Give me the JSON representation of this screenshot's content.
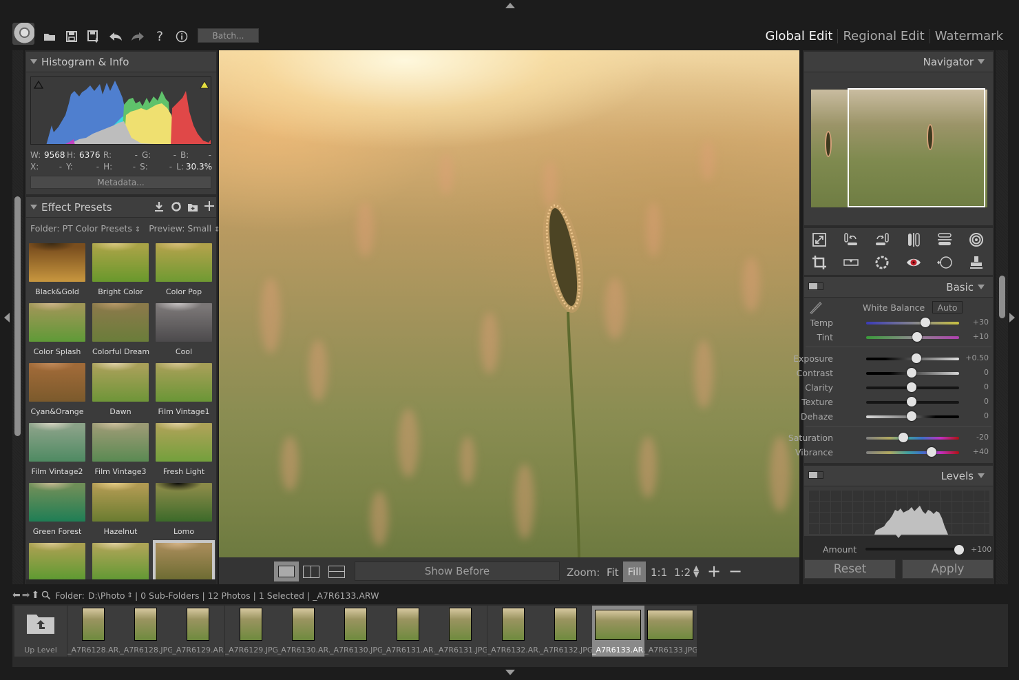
{
  "toolbar": {
    "icons": [
      "app-logo",
      "open-folder",
      "save",
      "save-as",
      "undo",
      "redo",
      "help",
      "info"
    ],
    "batch_label": "Batch...",
    "modes": [
      "Global Edit",
      "Regional Edit",
      "Watermark"
    ],
    "active_mode": "Global Edit"
  },
  "histogram_panel": {
    "title": "Histogram & Info",
    "info": {
      "w_label": "W:",
      "w": "9568",
      "h_label": "H:",
      "h": "6376",
      "r_label": "R:",
      "r": "-",
      "g_label": "G:",
      "g": "-",
      "b_label": "B:",
      "b": "-",
      "x_label": "X:",
      "x": "-",
      "y_label": "Y:",
      "y": "-",
      "hh_label": "H:",
      "hh": "-",
      "s_label": "S:",
      "s": "-",
      "l_label": "L:",
      "l": "30.3%"
    },
    "metadata_label": "Metadata..."
  },
  "presets_panel": {
    "title": "Effect Presets",
    "folder_label": "Folder:",
    "folder_value": "PT Color Presets",
    "preview_label": "Preview:",
    "preview_value": "Small",
    "presets": [
      {
        "name": "Black&Gold",
        "c1": "#7a4e1e",
        "c2": "#c8973f",
        "c3": "#3b2a12"
      },
      {
        "name": "Bright Color",
        "c1": "#a8a346",
        "c2": "#69982c",
        "c3": "#d9c882"
      },
      {
        "name": "Color Pop",
        "c1": "#b0a24a",
        "c2": "#6f9a32",
        "c3": "#d8c07a"
      },
      {
        "name": "Color Splash",
        "c1": "#9e9656",
        "c2": "#5f9a37",
        "c3": "#cdb58a"
      },
      {
        "name": "Colorful Dream",
        "c1": "#8a7a4a",
        "c2": "#6a7d3a",
        "c3": "#b89a6a"
      },
      {
        "name": "Cool",
        "c1": "#7b7777",
        "c2": "#4c4a4c",
        "c3": "#c8c4c4"
      },
      {
        "name": "Cyan&Orange",
        "c1": "#a06a38",
        "c2": "#7b5a2c",
        "c3": "#c08a5a"
      },
      {
        "name": "Dawn",
        "c1": "#a8a059",
        "c2": "#6e9538",
        "c3": "#e0d2a8"
      },
      {
        "name": "Film Vintage1",
        "c1": "#a59f57",
        "c2": "#6a9636",
        "c3": "#d6c692"
      },
      {
        "name": "Film Vintage2",
        "c1": "#8aa288",
        "c2": "#4e8a62",
        "c3": "#d4d2c0"
      },
      {
        "name": "Film Vintage3",
        "c1": "#9a9a74",
        "c2": "#5a8a52",
        "c3": "#ccc09e"
      },
      {
        "name": "Fresh Light",
        "c1": "#aca257",
        "c2": "#73a03c",
        "c3": "#e0d0a0"
      },
      {
        "name": "Green Forest",
        "c1": "#6e8e58",
        "c2": "#1f7e55",
        "c3": "#c4b892"
      },
      {
        "name": "Hazelnut",
        "c1": "#b09a52",
        "c2": "#6a7c30",
        "c3": "#e4cc86"
      },
      {
        "name": "Lomo",
        "c1": "#8a8a48",
        "c2": "#3c6a2a",
        "c3": "#0a0a08"
      },
      {
        "name": "",
        "c1": "#a8a050",
        "c2": "#5a9a30",
        "c3": "#d8c890"
      },
      {
        "name": "",
        "c1": "#aca456",
        "c2": "#5e9832",
        "c3": "#e0d0a0"
      },
      {
        "name": "",
        "c1": "#a58a58",
        "c2": "#6a6a30",
        "c3": "#d4b488",
        "selected": true
      }
    ]
  },
  "view_bar": {
    "show_before_label": "Show Before",
    "zoom_label": "Zoom:",
    "zoom_options": [
      "Fit",
      "Fill",
      "1:1",
      "1:2"
    ],
    "active_zoom": "Fill"
  },
  "navigator": {
    "title": "Navigator"
  },
  "tools": [
    "resize",
    "rotate-left",
    "rotate-right",
    "flip-horizontal",
    "flip-vertical",
    "lens-correction",
    "crop",
    "straighten",
    "noise-reduction",
    "red-eye",
    "vignette",
    "clone-stamp"
  ],
  "basic_panel": {
    "title": "Basic",
    "white_balance_label": "White Balance",
    "auto_label": "Auto",
    "sliders": [
      {
        "label": "Temp",
        "value": "+30",
        "pos": 0.64,
        "track": "linear-gradient(90deg,#3a3ab8,#8a8a8a 55%,#c8c040)"
      },
      {
        "label": "Tint",
        "value": "+10",
        "pos": 0.55,
        "track": "linear-gradient(90deg,#3a9a3a,#8a8a8a 50%,#b040b0)"
      },
      {
        "label": "Exposure",
        "value": "+0.50",
        "pos": 0.54,
        "track": "linear-gradient(90deg,#000 20%,#e0e0e0)"
      },
      {
        "label": "Contrast",
        "value": "0",
        "pos": 0.49,
        "track": "linear-gradient(90deg,#000 25%,#d8d8d8)"
      },
      {
        "label": "Clarity",
        "value": "0",
        "pos": 0.49,
        "track": "linear-gradient(90deg,#151515,#151515)"
      },
      {
        "label": "Texture",
        "value": "0",
        "pos": 0.49,
        "track": "linear-gradient(90deg,#151515,#151515)"
      },
      {
        "label": "Dehaze",
        "value": "0",
        "pos": 0.49,
        "track": "linear-gradient(90deg,#d8d8d8,#808080 45%,#000 75%)"
      },
      {
        "label": "Saturation",
        "value": "-20",
        "pos": 0.4,
        "track": "linear-gradient(90deg,#808080,#b0a860 25%,#40a0a0 45%,#3c70c8 60%,#c030c0 80%,#b01010)"
      },
      {
        "label": "Vibrance",
        "value": "+40",
        "pos": 0.7,
        "track": "linear-gradient(90deg,#808080,#b0a860 25%,#40a0a0 45%,#3c70c8 60%,#c030c0 80%,#b01010)"
      }
    ]
  },
  "levels_panel": {
    "title": "Levels",
    "amount_label": "Amount",
    "amount_value": "+100",
    "amount_pos": 1.0
  },
  "reset_label": "Reset",
  "apply_label": "Apply",
  "status_bar": {
    "folder_label": "Folder:",
    "folder_value": "D:\\Photo",
    "details": "| 0 Sub-Folders | 12 Photos | 1 Selected | _A7R6133.ARW"
  },
  "filmstrip": {
    "up_level_label": "Up Level",
    "items": [
      {
        "name": "_A7R6128.AR...",
        "orient": "portrait"
      },
      {
        "name": "_A7R6128.JPG",
        "orient": "portrait"
      },
      {
        "name": "_A7R6129.AR...",
        "orient": "portrait"
      },
      {
        "name": "_A7R6129.JPG",
        "orient": "portrait"
      },
      {
        "name": "_A7R6130.AR...",
        "orient": "portrait"
      },
      {
        "name": "_A7R6130.JPG",
        "orient": "portrait"
      },
      {
        "name": "_A7R6131.AR...",
        "orient": "portrait"
      },
      {
        "name": "_A7R6131.JPG",
        "orient": "portrait"
      },
      {
        "name": "_A7R6132.AR...",
        "orient": "portrait"
      },
      {
        "name": "_A7R6132.JPG",
        "orient": "portrait"
      },
      {
        "name": "_A7R6133.AR...",
        "orient": "landscape",
        "selected": true
      },
      {
        "name": "_A7R6133.JPG",
        "orient": "landscape"
      }
    ]
  }
}
